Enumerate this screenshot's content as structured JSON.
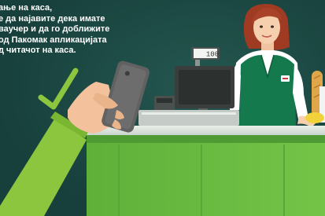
{
  "caption": {
    "lines": [
      "ање на каса,",
      "е да најавите дека имате",
      "ваучер и да го доближите",
      "од Пакомак апликацијата",
      "д читачот на каса."
    ]
  },
  "register": {
    "display_value": "100"
  },
  "colors": {
    "background": "#1c4a45",
    "counter_green": "#6fbf44",
    "uniform": "#147a4e",
    "checkmark": "#8cc63f",
    "phone": "#616161"
  },
  "icons": {
    "check": "check-mark-icon"
  }
}
